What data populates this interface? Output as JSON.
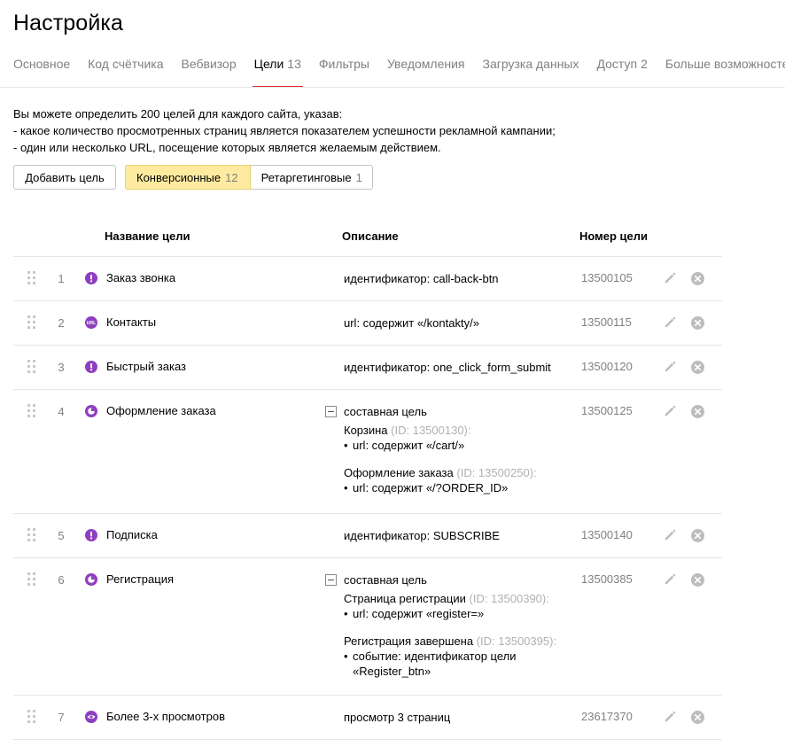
{
  "page": {
    "title": "Настройка"
  },
  "tabs": [
    {
      "label": "Основное",
      "count": ""
    },
    {
      "label": "Код счётчика",
      "count": ""
    },
    {
      "label": "Вебвизор",
      "count": ""
    },
    {
      "label": "Цели",
      "count": "13",
      "active": true
    },
    {
      "label": "Фильтры",
      "count": ""
    },
    {
      "label": "Уведомления",
      "count": ""
    },
    {
      "label": "Загрузка данных",
      "count": ""
    },
    {
      "label": "Доступ",
      "count": "2"
    },
    {
      "label": "Больше возможностей",
      "count": ""
    }
  ],
  "intro": {
    "line1": "Вы можете определить 200 целей для каждого сайта, указав:",
    "line2": "-  какое количество просмотренных страниц является показателем успешности рекламной кампании;",
    "line3": "-  один или несколько URL, посещение которых является желаемым действием."
  },
  "toolbar": {
    "add_label": "Добавить цель",
    "conversion_label": "Конверсионные",
    "conversion_count": "12",
    "retargeting_label": "Ретаргетинговые",
    "retargeting_count": "1"
  },
  "table": {
    "col_name": "Название цели",
    "col_desc": "Описание",
    "col_id": "Номер цели"
  },
  "goals": [
    {
      "num": "1",
      "icon": "exclamation-icon",
      "name": "Заказ звонка",
      "desc": "идентификатор: call-back-btn",
      "id": "13500105"
    },
    {
      "num": "2",
      "icon": "url-icon",
      "name": "Контакты",
      "desc": "url: содержит «/kontakty/»",
      "id": "13500115"
    },
    {
      "num": "3",
      "icon": "exclamation-icon",
      "name": "Быстрый заказ",
      "desc": "идентификатор: one_click_form_submit",
      "id": "13500120"
    },
    {
      "num": "4",
      "icon": "composite-icon",
      "name": "Оформление заказа",
      "desc": "составная цель",
      "id": "13500125",
      "steps": [
        {
          "name": "Корзина",
          "sid": "(ID: 13500130):",
          "cond": "url: содержит «/cart/»",
          "cond2": ""
        },
        {
          "name": "Оформление заказа",
          "sid": "(ID: 13500250):",
          "cond": "url: содержит «/?ORDER_ID»",
          "cond2": ""
        }
      ]
    },
    {
      "num": "5",
      "icon": "exclamation-icon",
      "name": "Подписка",
      "desc": "идентификатор: SUBSCRIBE",
      "id": "13500140"
    },
    {
      "num": "6",
      "icon": "composite-icon",
      "name": "Регистрация",
      "desc": "составная цель",
      "id": "13500385",
      "steps": [
        {
          "name": "Страница регистрации",
          "sid": "(ID: 13500390):",
          "cond": "url: содержит «register=»",
          "cond2": ""
        },
        {
          "name": "Регистрация завершена",
          "sid": "(ID: 13500395):",
          "cond": "событие: идентификатор цели",
          "cond2": "«Register_btn»"
        }
      ]
    },
    {
      "num": "7",
      "icon": "eye-icon",
      "name": "Более 3-х просмотров",
      "desc": "просмотр 3 страниц",
      "id": "23617370"
    }
  ],
  "colors": {
    "accent": "#e5282c",
    "goal_icon": "#8e3fbf",
    "switch_active": "#ffeba0",
    "muted": "#808080"
  }
}
